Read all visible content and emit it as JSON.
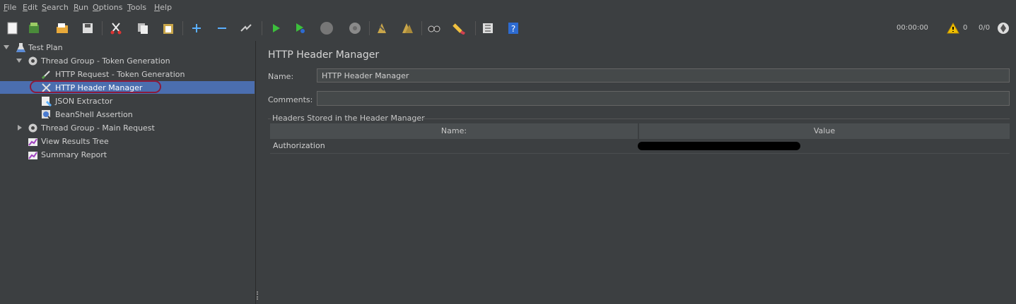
{
  "menu": [
    "File",
    "Edit",
    "Search",
    "Run",
    "Options",
    "Tools",
    "Help"
  ],
  "toolbar": {
    "timer": "00:00:00",
    "warnings": "0",
    "threads": "0/0",
    "icons": [
      "new-icon",
      "templates-icon",
      "open-icon",
      "save-icon",
      "cut-icon",
      "copy-icon",
      "paste-icon",
      "expand-icon",
      "collapse-icon",
      "toggle-icon",
      "start-icon",
      "start-no-pause-icon",
      "stop-icon",
      "shutdown-icon",
      "clear-icon",
      "clear-all-icon",
      "search-icon",
      "reset-search-icon",
      "function-helper-icon",
      "help-icon"
    ]
  },
  "tree": {
    "items": [
      {
        "label": "Test Plan",
        "icon": "flask-icon"
      },
      {
        "label": "Thread Group - Token Generation",
        "icon": "gear-icon"
      },
      {
        "label": "HTTP Request - Token Generation",
        "icon": "pipette-icon"
      },
      {
        "label": "HTTP Header Manager",
        "icon": "wrench-icon"
      },
      {
        "label": "JSON Extractor",
        "icon": "extractor-icon"
      },
      {
        "label": "BeanShell Assertion",
        "icon": "magnifier-icon"
      },
      {
        "label": "Thread Group - Main Request",
        "icon": "gear-icon"
      },
      {
        "label": "View Results Tree",
        "icon": "graph-icon"
      },
      {
        "label": "Summary Report",
        "icon": "graph-icon"
      }
    ]
  },
  "panel": {
    "title": "HTTP Header Manager",
    "name_label": "Name:",
    "name_value": "HTTP Header Manager",
    "comments_label": "Comments:",
    "comments_value": "",
    "group_title": "Headers Stored in the Header Manager",
    "columns": [
      "Name:",
      "Value"
    ],
    "rows": [
      {
        "name": "Authorization",
        "value": ""
      }
    ]
  },
  "colors": {
    "background": "#3c3f41",
    "selection": "#4b6eaf",
    "highlight_oval": "#8b1a3a"
  }
}
